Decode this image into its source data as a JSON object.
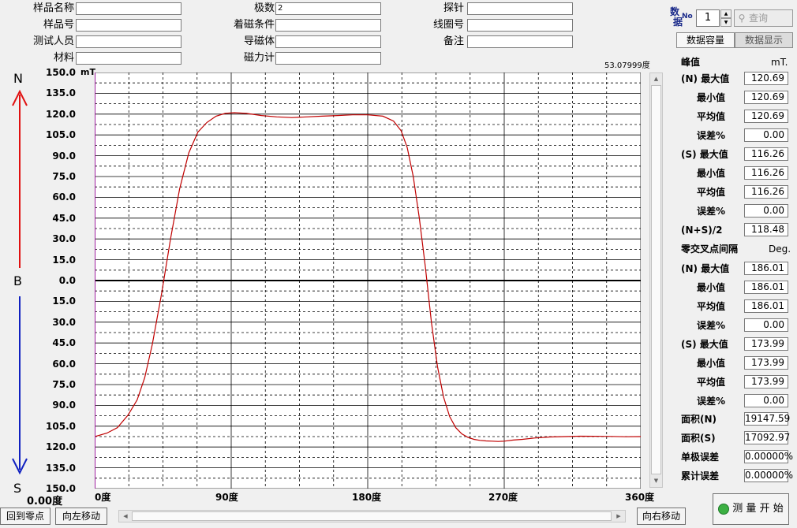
{
  "header": {
    "fields": [
      {
        "label": "样品名称",
        "value": ""
      },
      {
        "label": "极数",
        "value": "2"
      },
      {
        "label": "探针",
        "value": ""
      },
      {
        "label": "样品号",
        "value": ""
      },
      {
        "label": "着磁条件",
        "value": ""
      },
      {
        "label": "线圈号",
        "value": ""
      },
      {
        "label": "测试人员",
        "value": ""
      },
      {
        "label": "导磁体",
        "value": ""
      },
      {
        "label": "备注",
        "value": ""
      },
      {
        "label": "材料",
        "value": ""
      },
      {
        "label": "磁力计",
        "value": ""
      }
    ]
  },
  "data_panel": {
    "label_top": "数",
    "label_bottom": "据",
    "no_label": "No",
    "no_value": "1",
    "query_label": "查询",
    "tabs": [
      "数据容量",
      "数据显示"
    ]
  },
  "chart_data": {
    "type": "line",
    "angle_readout": "53.07999度",
    "yunit": "mT",
    "pole_north": "N",
    "pole_mid": "B",
    "pole_south": "S",
    "ylim": [
      -150,
      150
    ],
    "xlim": [
      0,
      360
    ],
    "ytick_labels": [
      "150.0",
      "135.0",
      "120.0",
      "105.0",
      "90.0",
      "75.0",
      "60.0",
      "45.0",
      "30.0",
      "15.0",
      "0.0",
      "15.0",
      "30.0",
      "45.0",
      "60.0",
      "75.0",
      "90.0",
      "105.0",
      "120.0",
      "135.0",
      "150.0"
    ],
    "xtick_labels": [
      "0度",
      "90度",
      "180度",
      "270度",
      "360度"
    ],
    "cursor_readout": "0.00度",
    "grid": true,
    "series": [
      {
        "color": "#c00000",
        "x": [
          0,
          8,
          15,
          22,
          28,
          33,
          38,
          44,
          50,
          56,
          62,
          68,
          74,
          80,
          86,
          92,
          100,
          110,
          120,
          130,
          140,
          150,
          160,
          170,
          180,
          190,
          197,
          202,
          206,
          210,
          214,
          218,
          222,
          226,
          230,
          234,
          238,
          242,
          246,
          250,
          254,
          258,
          262,
          266,
          270,
          276,
          282,
          290,
          300,
          310,
          320,
          330,
          340,
          350,
          360
        ],
        "y": [
          -112.5,
          -110,
          -106,
          -97,
          -86,
          -70,
          -46,
          -10,
          30,
          66,
          92,
          107,
          114,
          118.5,
          120.5,
          121,
          120.5,
          119,
          118,
          117.5,
          118,
          118.5,
          119,
          119.5,
          119.5,
          118.5,
          115,
          108,
          96,
          75,
          45,
          10,
          -30,
          -62,
          -84,
          -98,
          -106,
          -110.5,
          -113,
          -114.5,
          -115.2,
          -115.6,
          -115.8,
          -116,
          -115.8,
          -115,
          -114.5,
          -113.5,
          -112.8,
          -112.5,
          -112.2,
          -112.3,
          -112.4,
          -112.6,
          -112.5
        ]
      }
    ]
  },
  "right_panel": {
    "peak_title": "峰值",
    "peak_unit": "mT.",
    "peak_rows": [
      {
        "label": "(N) 最大值",
        "value": "120.69"
      },
      {
        "label": "最小值",
        "value": "120.69"
      },
      {
        "label": "平均值",
        "value": "120.69"
      },
      {
        "label": "误差%",
        "value": "0.00"
      },
      {
        "label": "(S) 最大值",
        "value": "116.26"
      },
      {
        "label": "最小值",
        "value": "116.26"
      },
      {
        "label": "平均值",
        "value": "116.26"
      },
      {
        "label": "误差%",
        "value": "0.00"
      },
      {
        "label": "(N+S)/2",
        "value": "118.48"
      }
    ],
    "zero_title": "零交叉点间隔",
    "zero_unit": "Deg.",
    "zero_rows": [
      {
        "label": "(N) 最大值",
        "value": "186.01"
      },
      {
        "label": "最小值",
        "value": "186.01"
      },
      {
        "label": "平均值",
        "value": "186.01"
      },
      {
        "label": "误差%",
        "value": "0.00"
      },
      {
        "label": "(S) 最大值",
        "value": "173.99"
      },
      {
        "label": "最小值",
        "value": "173.99"
      },
      {
        "label": "平均值",
        "value": "173.99"
      },
      {
        "label": "误差%",
        "value": "0.00"
      }
    ],
    "summary_rows": [
      {
        "label": "面积(N)",
        "value": "19147.59"
      },
      {
        "label": "面积(S)",
        "value": "17092.97"
      },
      {
        "label": "单极误差",
        "value": "0.00000%"
      },
      {
        "label": "累计误差",
        "value": "0.00000%"
      }
    ]
  },
  "bottom": {
    "back_zero": "回到零点",
    "move_left": "向左移动",
    "move_right": "向右移动",
    "start": "测 量 开 始"
  }
}
